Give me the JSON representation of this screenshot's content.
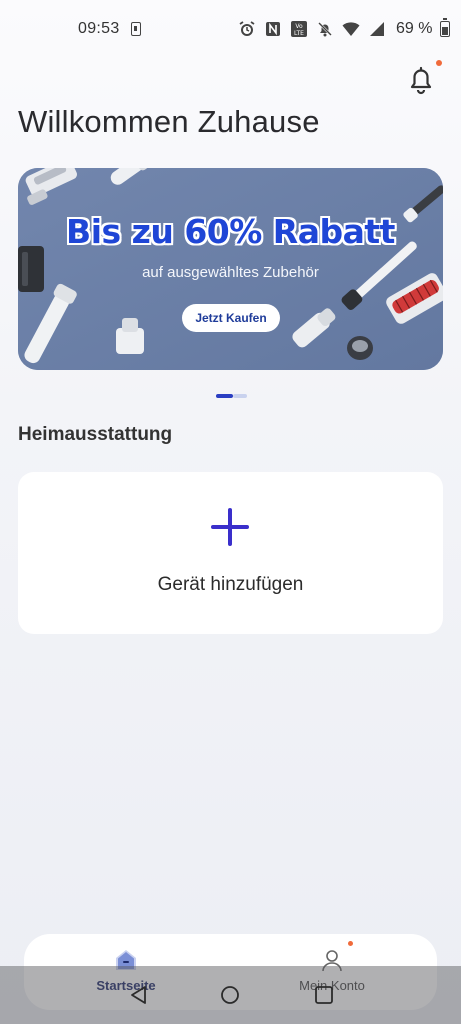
{
  "status_bar": {
    "time": "09:53",
    "battery_percent": "69 %",
    "icons": [
      "sim-icon",
      "alarm-icon",
      "nfc-icon",
      "volte-icon",
      "mute-icon",
      "wifi-icon",
      "signal-icon",
      "battery-icon"
    ]
  },
  "header": {
    "title": "Willkommen Zuhause",
    "notification_badge_color": "#f06a3a"
  },
  "banner": {
    "headline": "Bis zu 60% Rabatt",
    "subtitle": "auf ausgewähltes Zubehör",
    "cta": "Jetzt Kaufen",
    "background": "#6a7fa6",
    "headline_color": "#1f46d6"
  },
  "carousel": {
    "pages": 2,
    "active_index": 0
  },
  "section": {
    "title": "Heimausstattung"
  },
  "add_device": {
    "label": "Gerät hinzufügen",
    "accent_color": "#3a2fcb"
  },
  "bottom_nav": {
    "items": [
      {
        "label": "Startseite",
        "icon": "home-icon",
        "active": true
      },
      {
        "label": "Mein Konto",
        "icon": "person-icon",
        "active": false
      }
    ]
  },
  "system_nav": {
    "buttons": [
      "back-icon",
      "home-circle-icon",
      "recents-icon"
    ]
  }
}
